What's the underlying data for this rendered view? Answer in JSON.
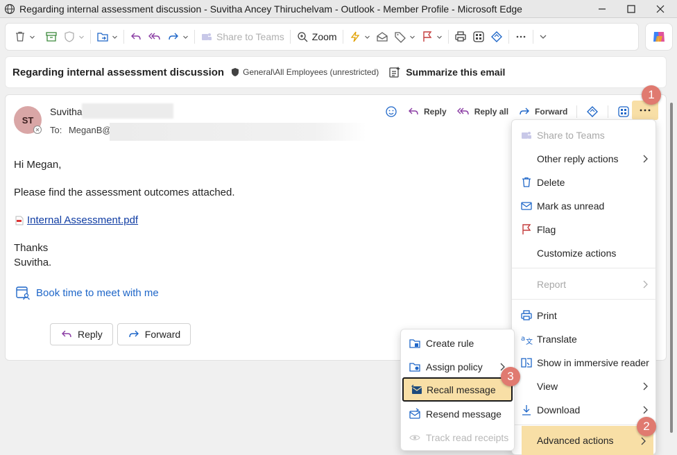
{
  "window": {
    "title": "Regarding internal assessment discussion - Suvitha Ancey Thiruchelvam - Outlook - Member Profile - Microsoft Edge"
  },
  "toolbar": {
    "share_to_teams": "Share to Teams",
    "zoom": "Zoom"
  },
  "subject_bar": {
    "subject": "Regarding internal assessment discussion",
    "sensitivity": "General\\All Employees (unrestricted)",
    "summarize": "Summarize this email"
  },
  "message": {
    "avatar_initials": "ST",
    "sender": "Suvitha",
    "to_label": "To:",
    "to_value": "MeganB@",
    "actions": {
      "reply": "Reply",
      "reply_all": "Reply all",
      "forward": "Forward"
    },
    "greeting": "Hi Megan,",
    "line1": "Please find the assessment outcomes attached.",
    "attachment": "Internal Assessment.pdf",
    "closing": "Thanks",
    "signature": "Suvitha.",
    "book_time": "Book time to meet with me",
    "reply_button": "Reply",
    "forward_button": "Forward"
  },
  "more_menu": {
    "items": [
      "Share to Teams",
      "Other reply actions",
      "Delete",
      "Mark as unread",
      "Flag",
      "Customize actions",
      "Report",
      "Print",
      "Translate",
      "Show in immersive reader",
      "View",
      "Download",
      "Advanced actions"
    ]
  },
  "advanced_submenu": {
    "items": [
      "Create rule",
      "Assign policy",
      "Recall message",
      "Resend message",
      "Track read receipts"
    ]
  },
  "badges": [
    "1",
    "2",
    "3"
  ],
  "colors": {
    "highlight": "#f8dfa6",
    "badge": "#e07a70",
    "link": "#0f3ca3",
    "accent": "#1e66c8"
  }
}
